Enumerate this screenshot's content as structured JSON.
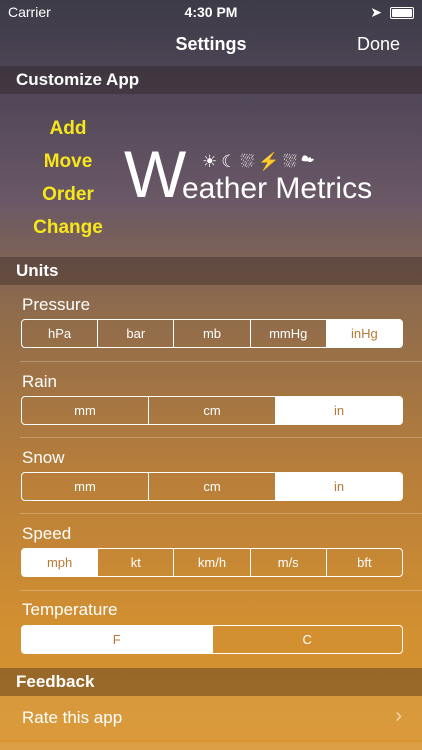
{
  "status": {
    "carrier": "Carrier",
    "time": "4:30 PM"
  },
  "nav": {
    "title": "Settings",
    "done": "Done"
  },
  "sections": {
    "customize": "Customize App",
    "units": "Units",
    "feedback": "Feedback"
  },
  "customize": {
    "actions": [
      "Add",
      "Move",
      "Order",
      "Change"
    ],
    "logo": {
      "letter": "W",
      "rest": "eather Metrics",
      "icons": "☀☾⛆⚡⛆☁"
    }
  },
  "units": {
    "pressure": {
      "label": "Pressure",
      "options": [
        "hPa",
        "bar",
        "mb",
        "mmHg",
        "inHg"
      ],
      "selected": "inHg"
    },
    "rain": {
      "label": "Rain",
      "options": [
        "mm",
        "cm",
        "in"
      ],
      "selected": "in"
    },
    "snow": {
      "label": "Snow",
      "options": [
        "mm",
        "cm",
        "in"
      ],
      "selected": "in"
    },
    "speed": {
      "label": "Speed",
      "options": [
        "mph",
        "kt",
        "km/h",
        "m/s",
        "bft"
      ],
      "selected": "mph"
    },
    "temperature": {
      "label": "Temperature",
      "options": [
        "F",
        "C"
      ],
      "selected": "F"
    }
  },
  "feedback": {
    "rate": "Rate this app",
    "chevron": "›"
  },
  "colors": {
    "accent_yellow": "#f7e71a",
    "selected_text": "#b67a35"
  }
}
